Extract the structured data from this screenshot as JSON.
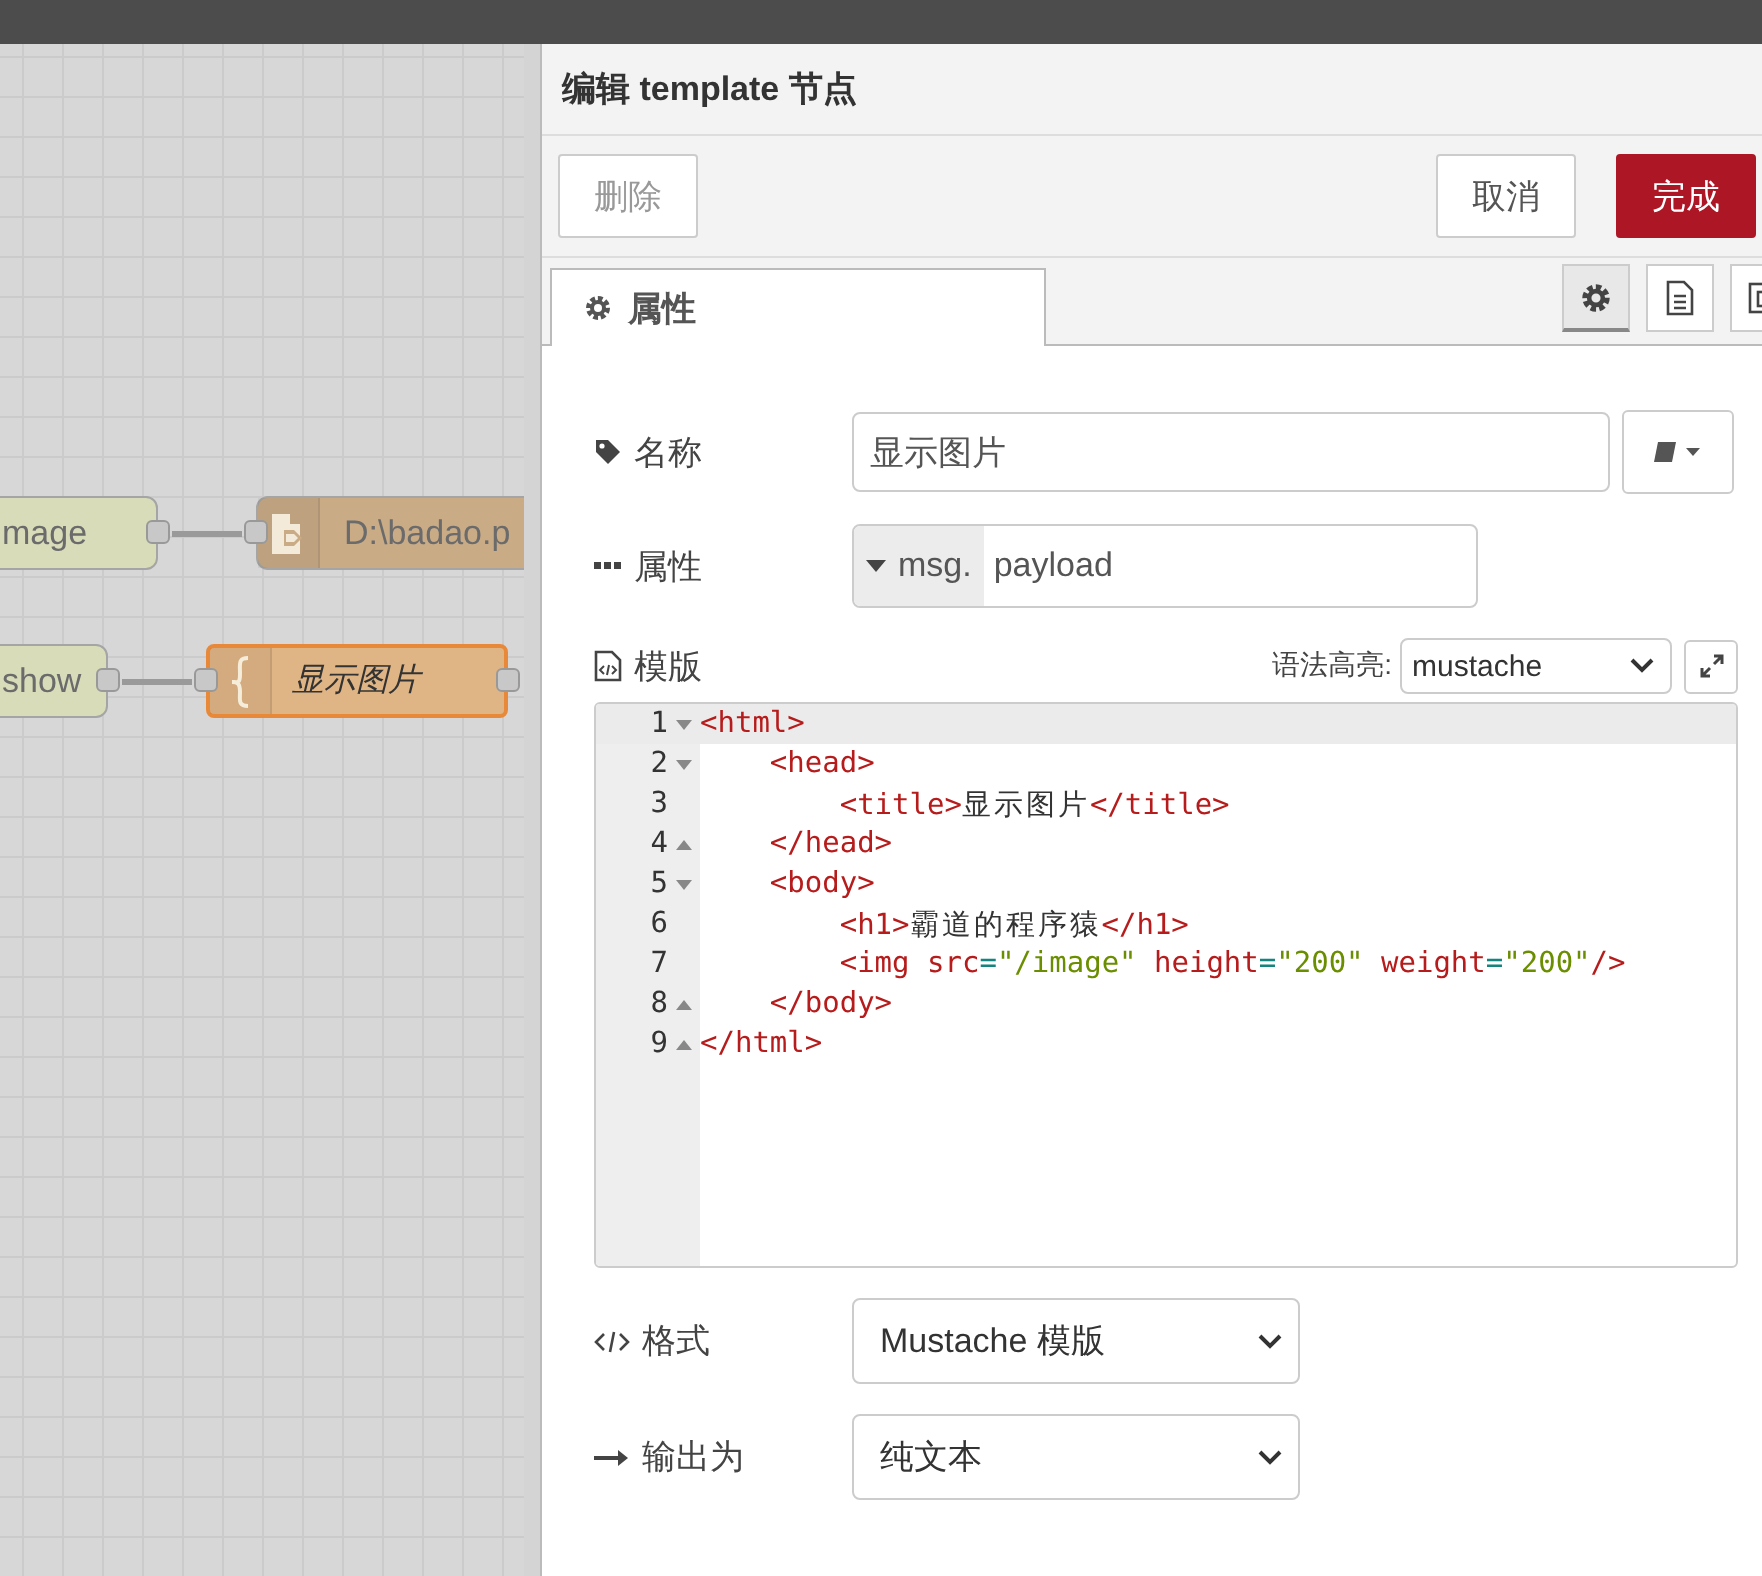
{
  "canvas": {
    "nodes": [
      {
        "kind": "inject",
        "label": "mage",
        "selected": false
      },
      {
        "kind": "file",
        "label": "D:\\badao.p",
        "selected": false
      },
      {
        "kind": "http",
        "label": "show",
        "selected": false
      },
      {
        "kind": "template",
        "label": "显示图片",
        "selected": true
      }
    ]
  },
  "panel": {
    "title": "编辑 template 节点",
    "buttons": [
      {
        "kind": "delete",
        "label": "删除",
        "disabled": true
      },
      {
        "kind": "cancel",
        "label": "取消",
        "disabled": false
      },
      {
        "kind": "done",
        "label": "完成",
        "disabled": false
      }
    ],
    "tabs": [
      {
        "label": "属性",
        "selected": true
      }
    ],
    "side_tabs": [
      {
        "kind": "settings",
        "selected": true
      },
      {
        "kind": "description",
        "selected": false
      },
      {
        "kind": "appearance",
        "selected": false
      }
    ],
    "fields": {
      "name": {
        "label": "名称",
        "value": "显示图片"
      },
      "property": {
        "label": "属性",
        "prefix": "msg.",
        "value": "payload"
      },
      "template": {
        "label": "模版",
        "syntax_label": "语法高亮:",
        "syntax": "mustache"
      },
      "format": {
        "label": "格式",
        "value": "Mustache 模版"
      },
      "output": {
        "label": "输出为",
        "value": "纯文本"
      }
    },
    "code": [
      {
        "number": "1",
        "kind": "opener",
        "active": true,
        "tokens": [
          {
            "kind": "tag",
            "text": "<html>"
          }
        ]
      },
      {
        "number": "2",
        "kind": "opener",
        "active": false,
        "tokens": [
          {
            "kind": "tag",
            "text": "    <head>"
          }
        ]
      },
      {
        "number": "3",
        "kind": "plain",
        "active": false,
        "tokens": [
          {
            "kind": "tag",
            "text": "        <title>"
          },
          {
            "kind": "text",
            "text": "显示图片"
          },
          {
            "kind": "tag",
            "text": "</title>"
          }
        ]
      },
      {
        "number": "4",
        "kind": "closer",
        "active": false,
        "tokens": [
          {
            "kind": "tag",
            "text": "    </head>"
          }
        ]
      },
      {
        "number": "5",
        "kind": "opener",
        "active": false,
        "tokens": [
          {
            "kind": "tag",
            "text": "    <body>"
          }
        ]
      },
      {
        "number": "6",
        "kind": "plain",
        "active": false,
        "tokens": [
          {
            "kind": "tag",
            "text": "        <h1>"
          },
          {
            "kind": "text",
            "text": "霸道的程序猿"
          },
          {
            "kind": "tag",
            "text": "</h1>"
          }
        ]
      },
      {
        "number": "7",
        "kind": "plain",
        "active": false,
        "tokens": [
          {
            "kind": "tag",
            "text": "        <img "
          },
          {
            "kind": "attr",
            "text": "src"
          },
          {
            "kind": "punct",
            "text": "="
          },
          {
            "kind": "string",
            "text": "\"/image\""
          },
          {
            "kind": "attr",
            "text": " height"
          },
          {
            "kind": "punct",
            "text": "="
          },
          {
            "kind": "string",
            "text": "\"200\""
          },
          {
            "kind": "attr",
            "text": " weight"
          },
          {
            "kind": "punct",
            "text": "="
          },
          {
            "kind": "string",
            "text": "\"200\""
          },
          {
            "kind": "tag",
            "text": "/>"
          }
        ]
      },
      {
        "number": "8",
        "kind": "closer",
        "active": false,
        "tokens": [
          {
            "kind": "tag",
            "text": "    </body>"
          }
        ]
      },
      {
        "number": "9",
        "kind": "closer",
        "active": false,
        "tokens": [
          {
            "kind": "tag",
            "text": "</html>"
          }
        ]
      }
    ]
  }
}
